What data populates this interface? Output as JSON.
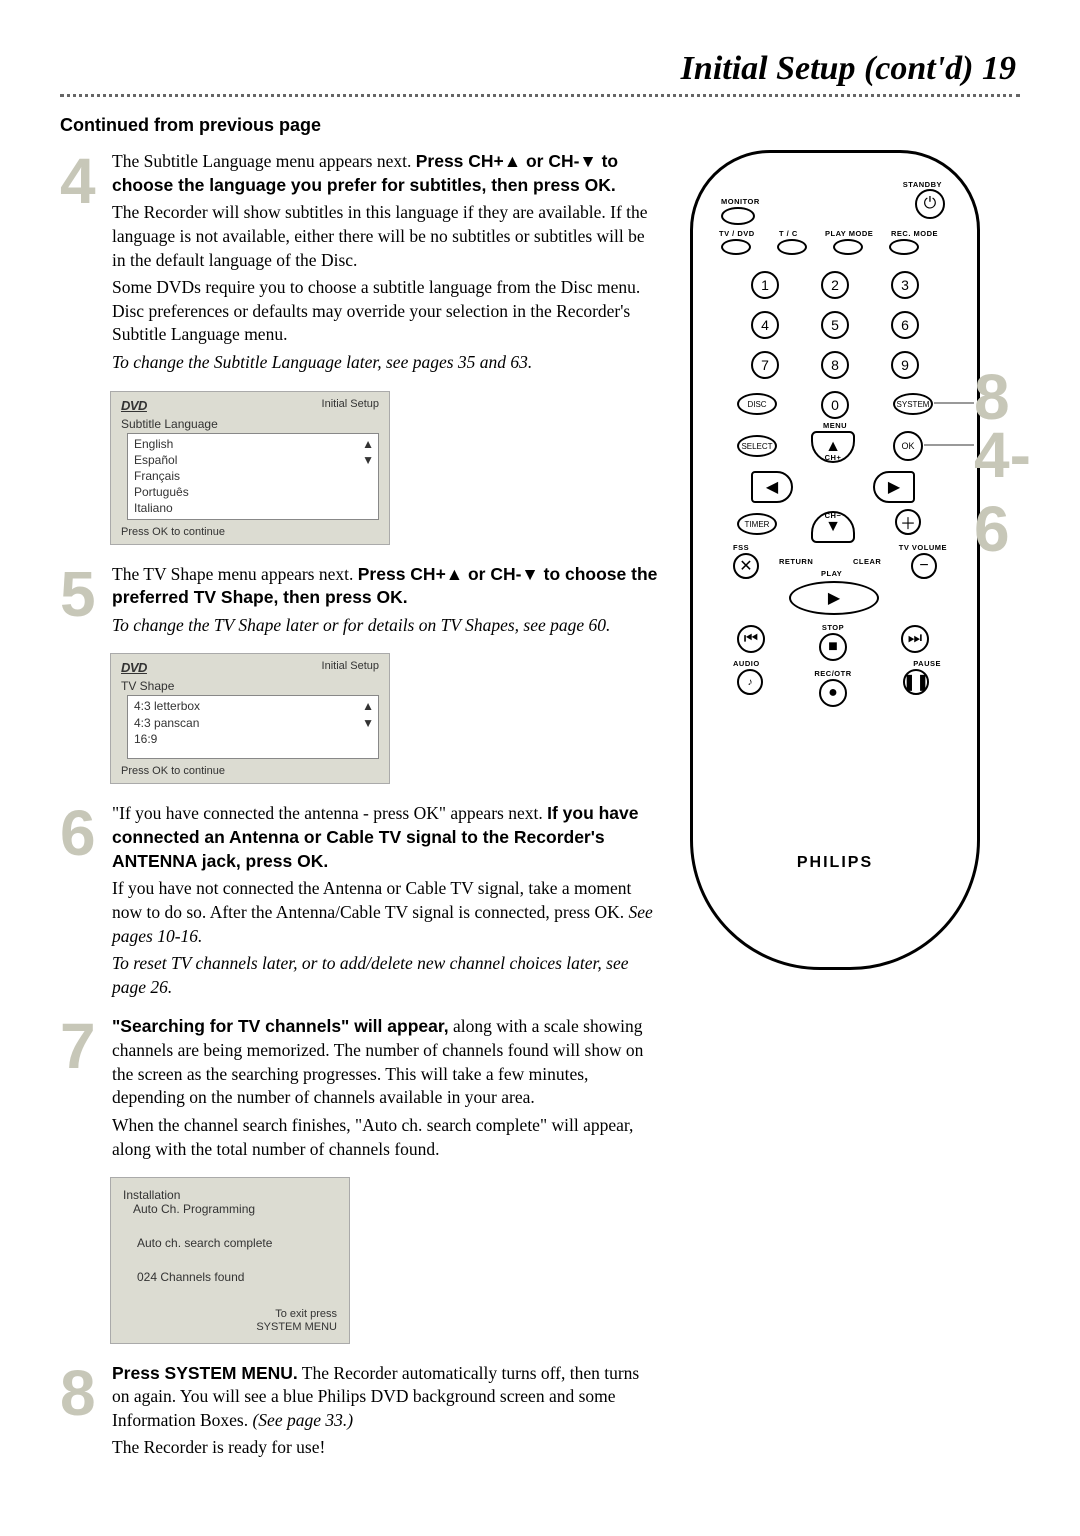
{
  "header": {
    "title": "Initial Setup (cont'd)",
    "page_number": "19"
  },
  "continued": "Continued from previous page",
  "steps": {
    "s4": {
      "num": "4",
      "intro1": "The Subtitle Language menu appears next. ",
      "bold1": "Press CH+▲ or CH-▼ to choose the language you prefer for subtitles, then press OK.",
      "p2": "The Recorder will show subtitles in this language if they are available. If the language is not available, either there will be no subtitles or subtitles will be in the default language of the Disc.",
      "p3": "Some DVDs require you to choose a subtitle language from the Disc menu. Disc preferences or defaults may override your selection in the Recorder's Subtitle Language menu.",
      "ital": "To change the Subtitle Language later, see pages 35 and 63."
    },
    "s5": {
      "num": "5",
      "intro1": "The TV Shape menu appears next. ",
      "bold1": "Press CH+▲ or CH-▼ to choose the preferred TV Shape, then press OK.",
      "ital": "To change the TV Shape later or for details on TV Shapes, see page 60."
    },
    "s6": {
      "num": "6",
      "intro1": "\"If you have connected the antenna - press OK\" appears next. ",
      "bold1": "If you have connected an Antenna or Cable TV signal to the Recorder's ANTENNA jack, press OK.",
      "p2a": "If you have not connected the Antenna or Cable TV signal, take a moment now to do so. After the Antenna/Cable TV signal is connected, press OK. ",
      "p2ital": "See pages 10-16.",
      "ital": "To reset TV channels later, or to add/delete new channel choices later, see page 26."
    },
    "s7": {
      "num": "7",
      "bold1": "\"Searching for TV channels\" will appear,",
      "rest1": " along with a scale showing channels are being memorized. The number of channels found will show on the screen as the searching progresses. This will take a few minutes, depending on the number of channels available in your area.",
      "p2": "When the channel search finishes, \"Auto ch. search complete\" will appear, along with the total number of channels found."
    },
    "s8": {
      "num": "8",
      "bold1": "Press SYSTEM MENU.",
      "rest1a": " The Recorder automatically turns off, then turns on again. You will see a blue Philips DVD background screen and some Information Boxes. ",
      "rest1ital": "(See page 33.)",
      "p2": "The Recorder is ready for use!"
    }
  },
  "menu_subtitle": {
    "dvd": "DVD",
    "header": "Initial Setup",
    "title": "Subtitle Language",
    "items": [
      "English",
      "Español",
      "Français",
      "Português",
      "Italiano"
    ],
    "footer": "Press OK to continue"
  },
  "menu_tvshape": {
    "dvd": "DVD",
    "header": "Initial Setup",
    "title": "TV Shape",
    "items": [
      "4:3 letterbox",
      "4:3 panscan",
      "16:9"
    ],
    "footer": "Press OK to continue"
  },
  "menu_install": {
    "line1": "Installation",
    "line2": "Auto Ch. Programming",
    "line3": "Auto ch. search complete",
    "line4": "024 Channels found",
    "exit1": "To exit press",
    "exit2": "SYSTEM MENU"
  },
  "remote": {
    "labels": {
      "standby": "STANDBY",
      "monitor": "MONITOR",
      "tvdvd": "TV / DVD",
      "tc": "T / C",
      "playmode": "PLAY MODE",
      "recmode": "REC. MODE",
      "disc": "DISC",
      "menu_under0": "MENU",
      "system": "SYSTEM",
      "select": "SELECT",
      "ok": "OK",
      "chplus": "CH+",
      "chminus": "CH−",
      "timer": "TIMER",
      "fss": "FSS",
      "tvvolume": "TV VOLUME",
      "return": "RETURN",
      "clear": "CLEAR",
      "play": "PLAY",
      "stop": "STOP",
      "audio": "AUDIO",
      "pause": "PAUSE",
      "recotr": "REC/OTR"
    },
    "numbers": [
      "1",
      "2",
      "3",
      "4",
      "5",
      "6",
      "7",
      "8",
      "9",
      "0"
    ],
    "brand": "PHILIPS"
  },
  "callouts": {
    "c8": "8",
    "c46": "4-6"
  }
}
